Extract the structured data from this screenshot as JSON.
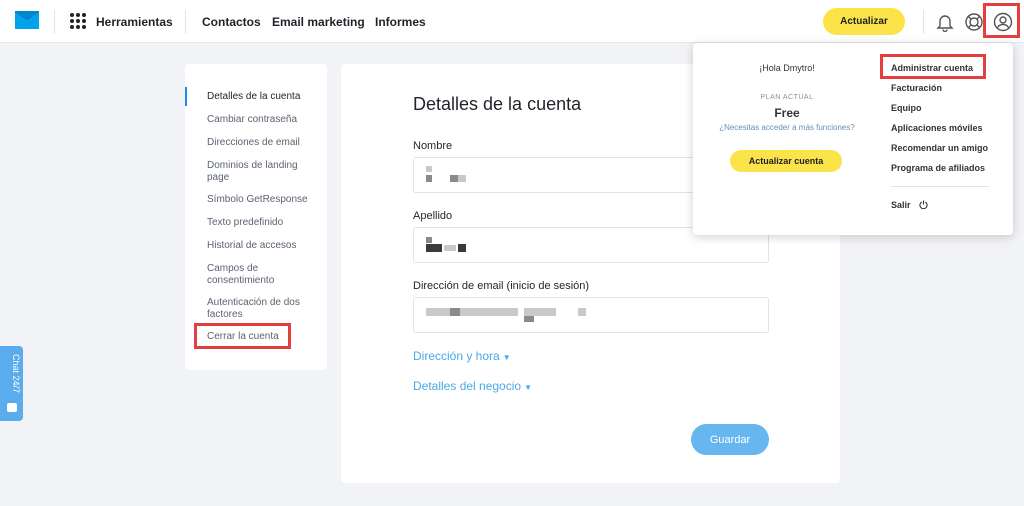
{
  "header": {
    "tools_label": "Herramientas",
    "nav": [
      "Contactos",
      "Email marketing",
      "Informes"
    ],
    "upgrade_label": "Actualizar"
  },
  "sidebar": {
    "items": [
      {
        "label": "Detalles de la cuenta",
        "active": true
      },
      {
        "label": "Cambiar contraseña"
      },
      {
        "label": "Direcciones de email"
      },
      {
        "label": "Dominios de landing page"
      },
      {
        "label": "Símbolo GetResponse"
      },
      {
        "label": "Texto predefinido"
      },
      {
        "label": "Historial de accesos"
      },
      {
        "label": "Campos de consentimiento"
      },
      {
        "label": "Autenticación de dos factores"
      },
      {
        "label": "Cerrar la cuenta"
      }
    ]
  },
  "main": {
    "title": "Detalles de la cuenta",
    "fields": [
      {
        "label": "Nombre"
      },
      {
        "label": "Apellido"
      },
      {
        "label": "Dirección de email (inicio de sesión)"
      }
    ],
    "links": [
      "Dirección y hora",
      "Detalles del negocio"
    ],
    "save_label": "Guardar"
  },
  "dropdown": {
    "greeting": "¡Hola Dmytro!",
    "plan_label": "PLAN ACTUAL",
    "plan": "Free",
    "need_more": "¿Necesitas acceder a más funciones?",
    "upgrade_account": "Actualizar cuenta",
    "menu": [
      "Administrar cuenta",
      "Facturación",
      "Equipo",
      "Aplicaciones móviles",
      "Recomendar un amigo",
      "Programa de afiliados"
    ],
    "logout": "Salir"
  },
  "chat": {
    "label": "Chat 24/7"
  },
  "colors": {
    "accent": "#1e88e5",
    "yellow": "#fbe34a",
    "highlight": "#e53e3e",
    "link": "#4ba8e8"
  }
}
